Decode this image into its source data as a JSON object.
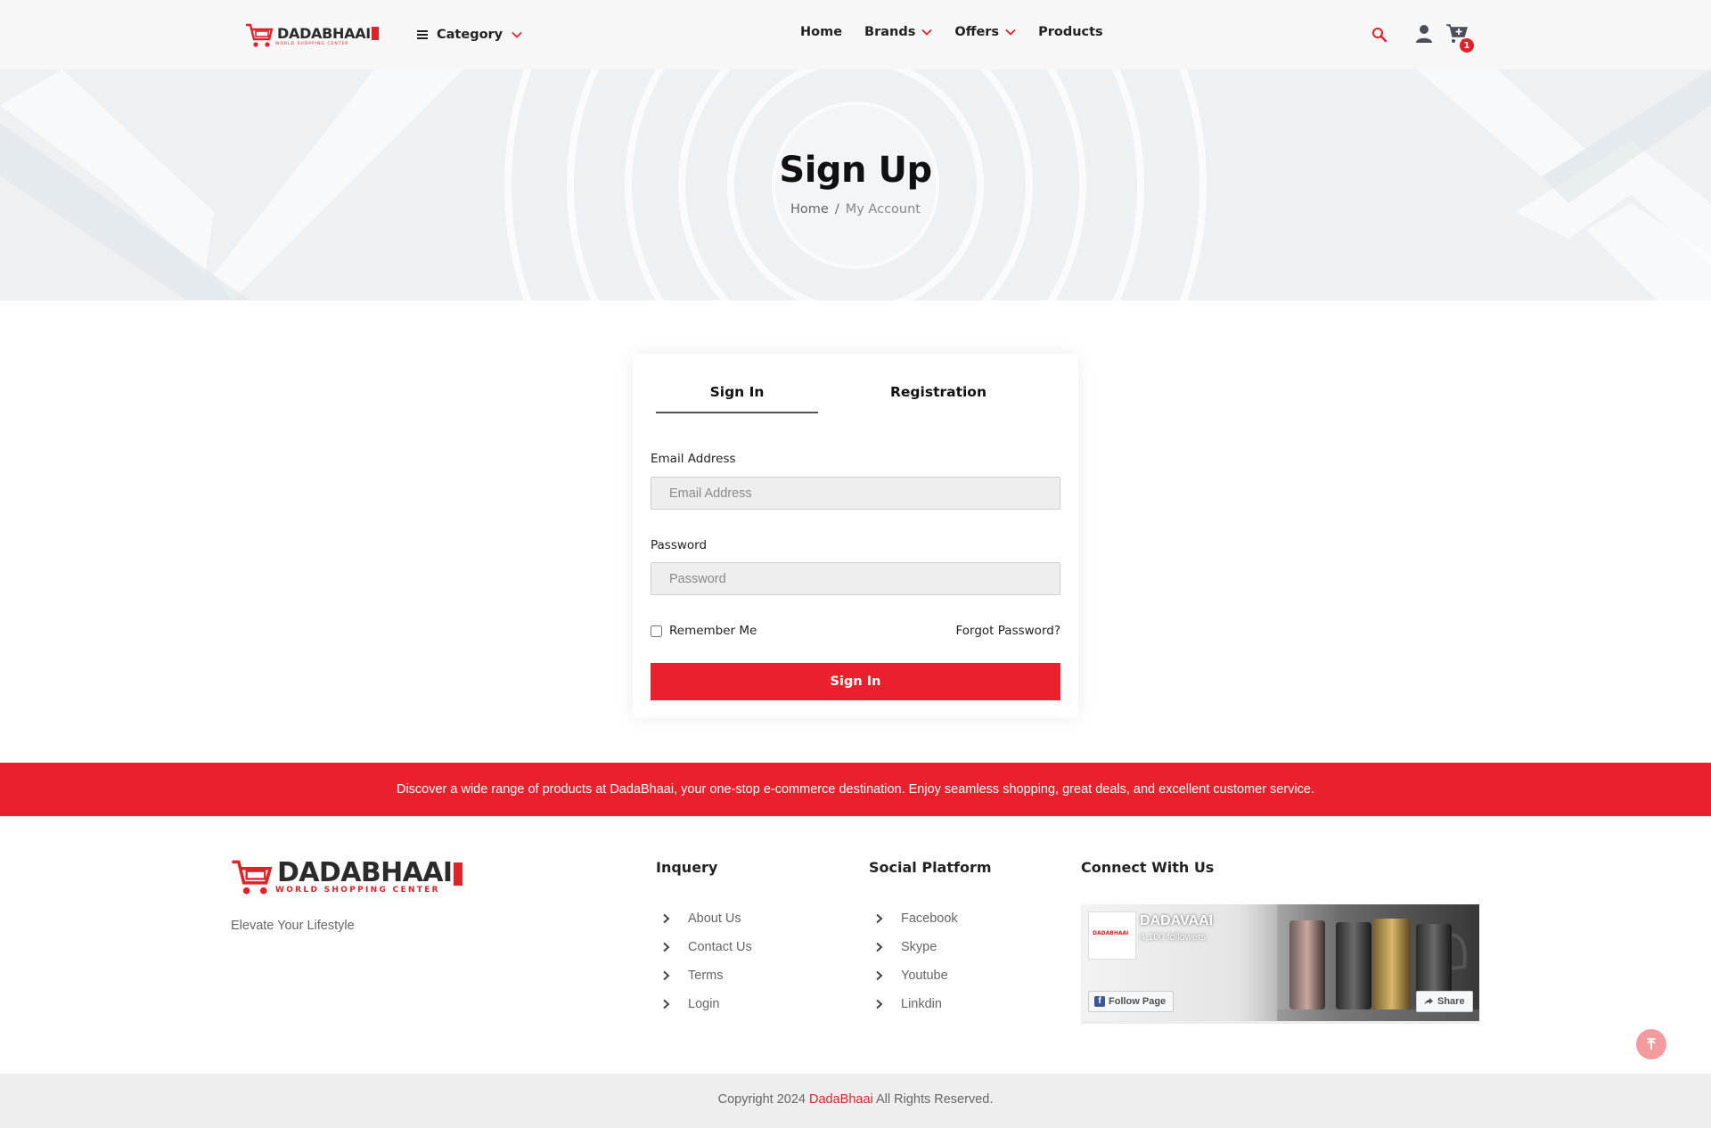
{
  "header": {
    "logo": {
      "brand": "DADABHAAI",
      "sub": "WORLD SHOPPING CENTER"
    },
    "category_label": "Category",
    "nav": [
      {
        "label": "Home",
        "has_dropdown": false
      },
      {
        "label": "Brands",
        "has_dropdown": true
      },
      {
        "label": "Offers",
        "has_dropdown": true
      },
      {
        "label": "Products",
        "has_dropdown": false
      }
    ],
    "cart_count": "1",
    "icons": [
      "search-icon",
      "user-icon",
      "cart-icon"
    ]
  },
  "hero": {
    "title": "Sign Up",
    "breadcrumb": {
      "home": "Home",
      "separator": "/",
      "current": "My Account"
    }
  },
  "auth": {
    "tabs": {
      "signin": "Sign In",
      "registration": "Registration"
    },
    "active_tab": "Sign In",
    "email": {
      "label": "Email Address",
      "placeholder": "Email Address",
      "value": ""
    },
    "password": {
      "label": "Password",
      "placeholder": "Password",
      "value": ""
    },
    "remember_label": "Remember Me",
    "remember_checked": false,
    "forgot_label": "Forgot Password?",
    "submit_label": "Sign In"
  },
  "banner": {
    "text": "Discover a wide range of products at DadaBhaai, your one-stop e-commerce destination. Enjoy seamless shopping, great deals, and excellent customer service."
  },
  "footer": {
    "logo": {
      "brand": "DADABHAAI",
      "sub": "WORLD SHOPPING CENTER"
    },
    "tagline": "Elevate Your Lifestyle",
    "inquery": {
      "title": "Inquery",
      "items": [
        "About Us",
        "Contact Us",
        "Terms",
        "Login"
      ]
    },
    "social": {
      "title": "Social Platform",
      "items": [
        "Facebook",
        "Skype",
        "Youtube",
        "Linkdin"
      ]
    },
    "connect": {
      "title": "Connect With Us",
      "fb_page_name": "DADAVAAI",
      "fb_followers": "4,100 followers",
      "fb_follow_label": "Follow Page",
      "fb_share_label": "Share"
    },
    "copyright": {
      "prefix": "Copyright 2024 ",
      "brand": "DadaBhaai",
      "suffix": " All Rights Reserved."
    }
  },
  "colors": {
    "accent": "#ec1f2d",
    "text": "#222222",
    "muted": "#666666"
  }
}
